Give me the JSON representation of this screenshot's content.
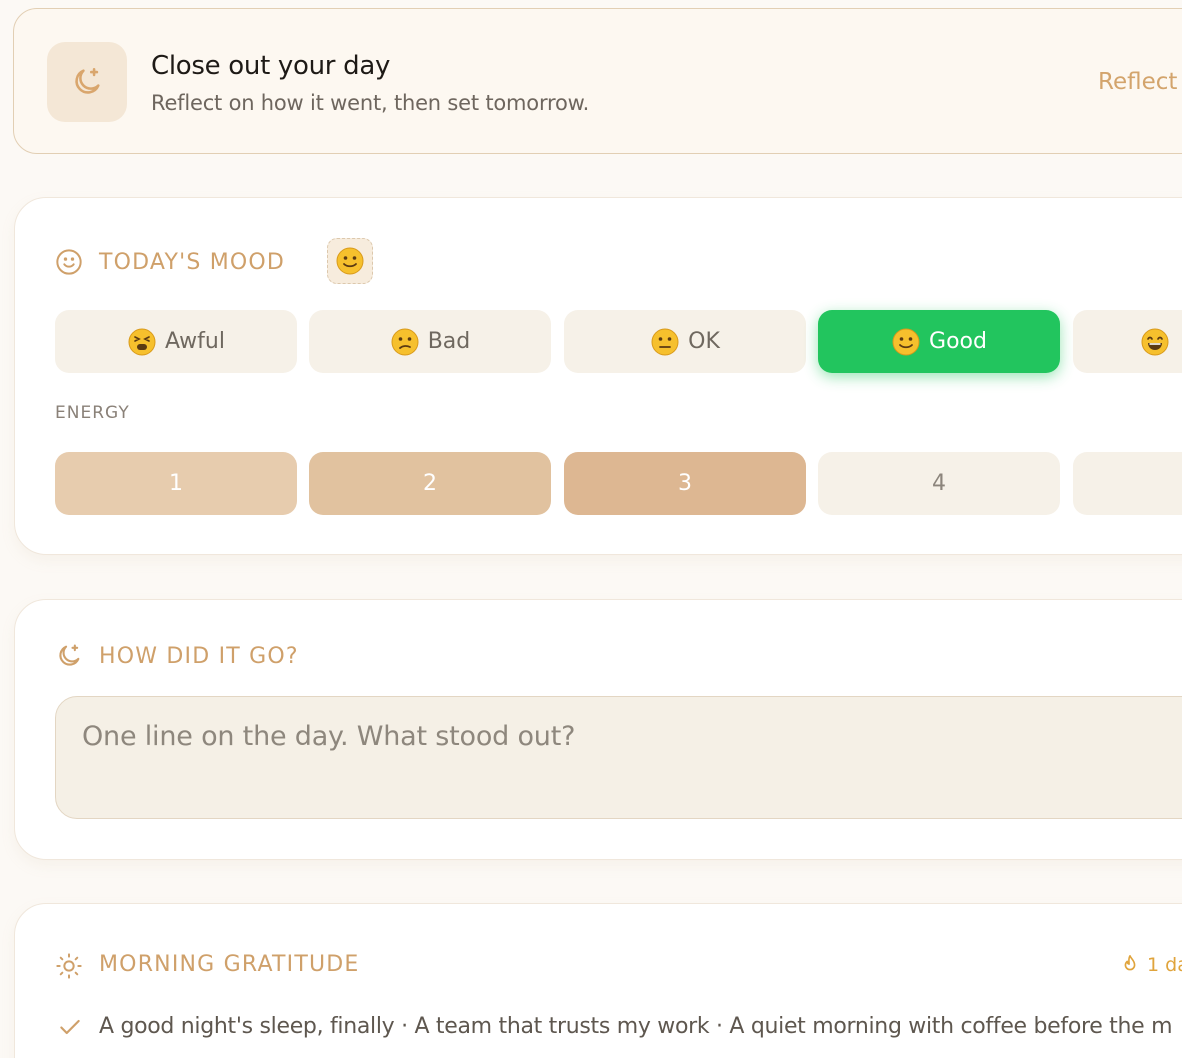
{
  "header": {
    "title": "Close out your day",
    "subtitle": "Reflect on how it went, then set tomorrow.",
    "action": "Reflect"
  },
  "mood": {
    "label": "TODAY'S MOOD",
    "options": [
      {
        "label": "Awful",
        "emoji": "tired-face-emoji"
      },
      {
        "label": "Bad",
        "emoji": "confused-face-emoji"
      },
      {
        "label": "OK",
        "emoji": "neutral-face-emoji"
      },
      {
        "label": "Good",
        "emoji": "smiling-face-emoji"
      },
      {
        "label": "",
        "emoji": "grinning-face-emoji"
      }
    ],
    "selected": "Good",
    "energy_label": "ENERGY",
    "energy_levels": [
      "1",
      "2",
      "3",
      "4",
      ""
    ],
    "energy_selected": 3
  },
  "reflection": {
    "label": "HOW DID IT GO?",
    "placeholder": "One line on the day. What stood out?"
  },
  "gratitude": {
    "label": "MORNING GRATITUDE",
    "streak": "1 da",
    "entries": "A good night's sleep, finally · A team that trusts my work · A quiet morning with coffee before the m"
  },
  "colors": {
    "accent": "#cfa06a",
    "selected_mood": "#22c55e",
    "streak": "#e0a43c"
  }
}
